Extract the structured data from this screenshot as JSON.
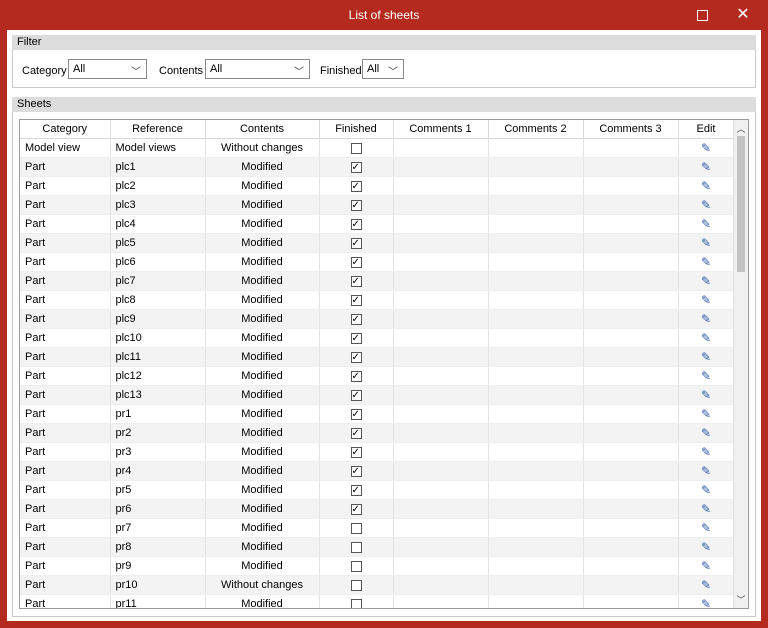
{
  "window": {
    "title": "List of sheets"
  },
  "filter": {
    "header": "Filter",
    "category_label": "Category",
    "category_value": "All",
    "contents_label": "Contents",
    "contents_value": "All",
    "finished_label": "Finished",
    "finished_value": "All"
  },
  "sheets": {
    "header": "Sheets",
    "columns": [
      "Category",
      "Reference",
      "Contents",
      "Finished",
      "Comments 1",
      "Comments 2",
      "Comments 3",
      "Edit"
    ],
    "rows": [
      {
        "category": "Model view",
        "reference": "Model views",
        "contents": "Without changes",
        "finished": false
      },
      {
        "category": "Part",
        "reference": "plc1",
        "contents": "Modified",
        "finished": true
      },
      {
        "category": "Part",
        "reference": "plc2",
        "contents": "Modified",
        "finished": true
      },
      {
        "category": "Part",
        "reference": "plc3",
        "contents": "Modified",
        "finished": true
      },
      {
        "category": "Part",
        "reference": "plc4",
        "contents": "Modified",
        "finished": true
      },
      {
        "category": "Part",
        "reference": "plc5",
        "contents": "Modified",
        "finished": true
      },
      {
        "category": "Part",
        "reference": "plc6",
        "contents": "Modified",
        "finished": true
      },
      {
        "category": "Part",
        "reference": "plc7",
        "contents": "Modified",
        "finished": true
      },
      {
        "category": "Part",
        "reference": "plc8",
        "contents": "Modified",
        "finished": true
      },
      {
        "category": "Part",
        "reference": "plc9",
        "contents": "Modified",
        "finished": true
      },
      {
        "category": "Part",
        "reference": "plc10",
        "contents": "Modified",
        "finished": true
      },
      {
        "category": "Part",
        "reference": "plc11",
        "contents": "Modified",
        "finished": true
      },
      {
        "category": "Part",
        "reference": "plc12",
        "contents": "Modified",
        "finished": true
      },
      {
        "category": "Part",
        "reference": "plc13",
        "contents": "Modified",
        "finished": true
      },
      {
        "category": "Part",
        "reference": "pr1",
        "contents": "Modified",
        "finished": true
      },
      {
        "category": "Part",
        "reference": "pr2",
        "contents": "Modified",
        "finished": true
      },
      {
        "category": "Part",
        "reference": "pr3",
        "contents": "Modified",
        "finished": true
      },
      {
        "category": "Part",
        "reference": "pr4",
        "contents": "Modified",
        "finished": true
      },
      {
        "category": "Part",
        "reference": "pr5",
        "contents": "Modified",
        "finished": true
      },
      {
        "category": "Part",
        "reference": "pr6",
        "contents": "Modified",
        "finished": true
      },
      {
        "category": "Part",
        "reference": "pr7",
        "contents": "Modified",
        "finished": false
      },
      {
        "category": "Part",
        "reference": "pr8",
        "contents": "Modified",
        "finished": false
      },
      {
        "category": "Part",
        "reference": "pr9",
        "contents": "Modified",
        "finished": false
      },
      {
        "category": "Part",
        "reference": "pr10",
        "contents": "Without changes",
        "finished": false
      },
      {
        "category": "Part",
        "reference": "pr11",
        "contents": "Modified",
        "finished": false
      }
    ]
  },
  "colors": {
    "titlebar": "#b52a1e",
    "edit_icon": "#2a5aa8"
  },
  "icons": {
    "maximize": "maximize-icon",
    "close": "close-icon",
    "dropdown": "chevron-down-icon",
    "edit": "pencil-icon",
    "scroll_up": "chevron-up-icon",
    "scroll_down": "chevron-down-icon"
  }
}
